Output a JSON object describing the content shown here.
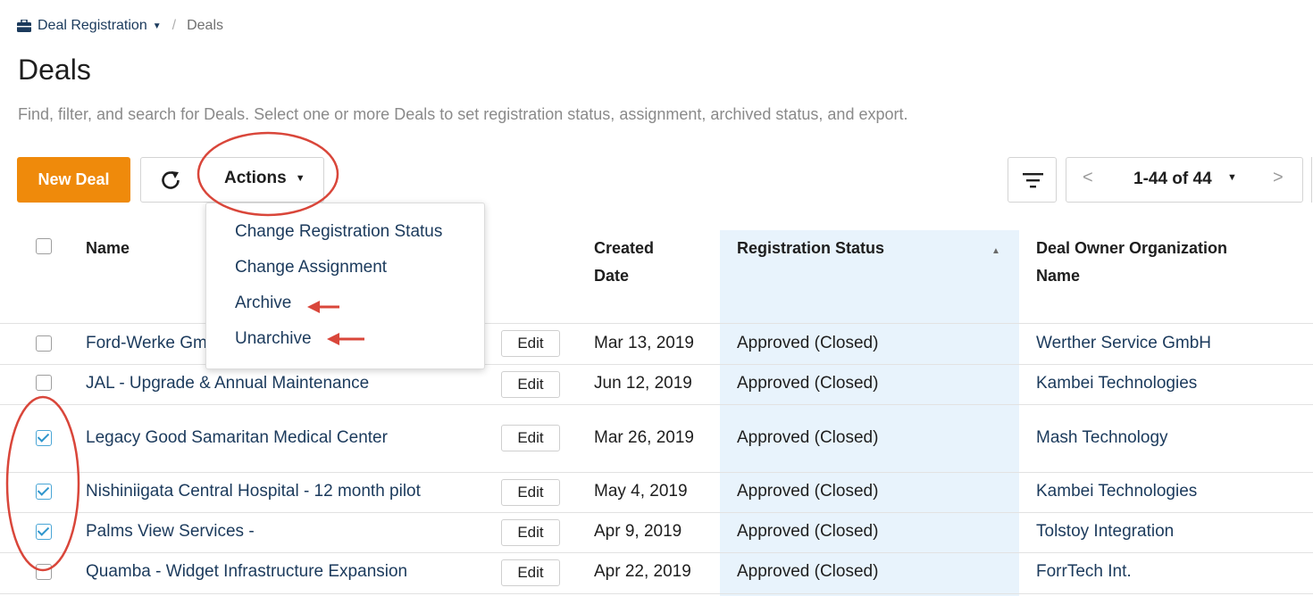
{
  "breadcrumb": {
    "section": "Deal Registration",
    "current": "Deals"
  },
  "page": {
    "title": "Deals",
    "subtitle": "Find, filter, and search for Deals. Select one or more Deals to set registration status, assignment, archived status, and export."
  },
  "toolbar": {
    "new_deal": "New Deal",
    "actions": "Actions"
  },
  "pager": {
    "label": "1-44 of 44"
  },
  "table": {
    "headers": {
      "name": "Name",
      "created_1": "Created",
      "created_2": "Date",
      "status": "Registration Status",
      "owner_1": "Deal Owner Organization",
      "owner_2": "Name"
    },
    "edit_label": "Edit",
    "rows": [
      {
        "name": "Ford-Werke Gm",
        "date": "Mar 13, 2019",
        "status": "Approved (Closed)",
        "owner": "Werther Service GmbH",
        "checked": false
      },
      {
        "name": "JAL - Upgrade & Annual Maintenance",
        "date": "Jun 12, 2019",
        "status": "Approved (Closed)",
        "owner": "Kambei Technologies",
        "checked": false
      },
      {
        "name": "Legacy Good Samaritan Medical Center",
        "date": "Mar 26, 2019",
        "status": "Approved (Closed)",
        "owner": "Mash Technology",
        "checked": true
      },
      {
        "name": "Nishiniigata Central Hospital - 12 month pilot",
        "date": "May 4, 2019",
        "status": "Approved (Closed)",
        "owner": "Kambei Technologies",
        "checked": true
      },
      {
        "name": "Palms View Services -",
        "date": "Apr 9, 2019",
        "status": "Approved (Closed)",
        "owner": "Tolstoy Integration",
        "checked": true
      },
      {
        "name": "Quamba - Widget Infrastructure Expansion",
        "date": "Apr 22, 2019",
        "status": "Approved (Closed)",
        "owner": "ForrTech Int.",
        "checked": false
      }
    ]
  },
  "actions_menu": {
    "items": [
      "Change Registration Status",
      "Change Assignment",
      "Archive",
      "Unarchive"
    ]
  },
  "colors": {
    "accent_orange": "#ef8a0b",
    "link_navy": "#1b3a5c",
    "status_column_bg": "#e8f3fc",
    "annotation_red": "#d9463a"
  }
}
